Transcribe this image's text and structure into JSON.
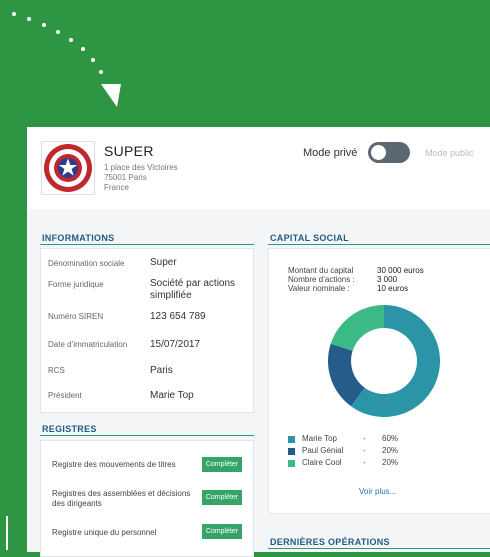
{
  "header": {
    "company_name": "SUPER",
    "address": [
      "1 place des Victoires",
      "75001 Paris",
      "France"
    ],
    "mode_private_label": "Mode privé",
    "mode_public_label": "Mode public"
  },
  "informations": {
    "title": "INFORMATIONS",
    "rows": [
      {
        "label": "Dénomination sociale",
        "value": "Super"
      },
      {
        "label": "Forme juridique",
        "value": "Société par actions simplifiée"
      },
      {
        "label": "Numéro SIREN",
        "value": "123 654 789"
      },
      {
        "label": "Date d’immatriculation",
        "value": "15/07/2017"
      },
      {
        "label": "RCS",
        "value": "Paris"
      },
      {
        "label": "Président",
        "value": "Marie Top"
      }
    ]
  },
  "registres": {
    "title": "REGISTRES",
    "rows": [
      {
        "label": "Registre des mouvements de titres",
        "button": "Compléter"
      },
      {
        "label": "Registres des assemblées et décisions des dirigeants",
        "button": "Compléter"
      },
      {
        "label": "Registre unique du personnel",
        "button": "Compléter"
      }
    ]
  },
  "capital": {
    "title": "CAPITAL SOCIAL",
    "rows": [
      {
        "label": "Montant du capital",
        "value": "30 000 euros"
      },
      {
        "label": "Nombre d’actions :",
        "value": "3 000"
      },
      {
        "label": "Valeur nominale :",
        "value": "10 euros"
      }
    ],
    "shareholders": [
      {
        "name": "Marie Top",
        "dash": "-",
        "pct_label": "60%",
        "share": 60,
        "color": "#2b94a6"
      },
      {
        "name": "Paul Génial",
        "dash": "-",
        "pct_label": "20%",
        "share": 20,
        "color": "#255c8a"
      },
      {
        "name": "Claire Cool",
        "dash": "-",
        "pct_label": "20%",
        "share": 20,
        "color": "#3cba86"
      }
    ],
    "voir_plus": "Voir plus..."
  },
  "operations": {
    "title": "DERNIÈRES OPÉRATIONS"
  },
  "colors": {
    "background": "#2e9643",
    "accent": "#35a468",
    "section_title": "#1f5b86"
  }
}
